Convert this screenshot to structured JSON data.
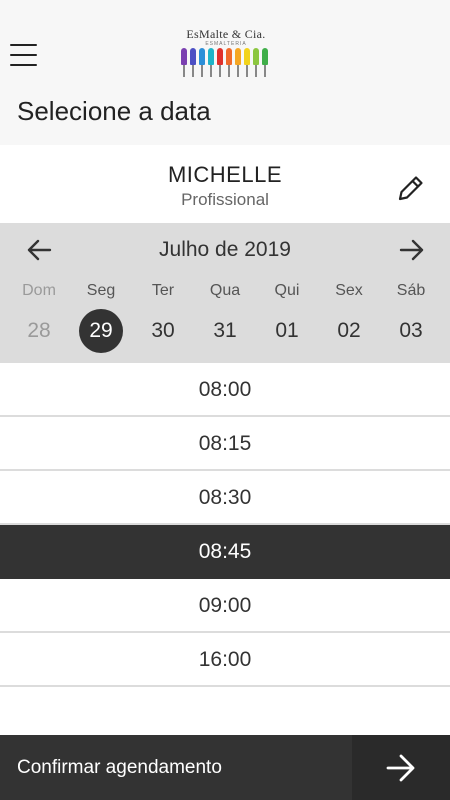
{
  "header": {
    "logo_text": "EsMalte & Cia.",
    "logo_subtext": "ESMALTERIA",
    "brush_colors": [
      "#7a3fb0",
      "#4b4fc4",
      "#2b8fd8",
      "#1fb4c8",
      "#e0302c",
      "#f06a2b",
      "#f5a623",
      "#f2d31b",
      "#8cc63f",
      "#3fae49"
    ]
  },
  "page": {
    "title": "Selecione a data"
  },
  "professional": {
    "name": "MICHELLE",
    "role": "Profissional"
  },
  "calendar": {
    "month_label": "Julho de 2019",
    "days": [
      {
        "name": "Dom",
        "num": "28",
        "state": "muted"
      },
      {
        "name": "Seg",
        "num": "29",
        "state": "selected"
      },
      {
        "name": "Ter",
        "num": "30",
        "state": "normal"
      },
      {
        "name": "Qua",
        "num": "31",
        "state": "normal"
      },
      {
        "name": "Qui",
        "num": "01",
        "state": "normal"
      },
      {
        "name": "Sex",
        "num": "02",
        "state": "normal"
      },
      {
        "name": "Sáb",
        "num": "03",
        "state": "normal"
      }
    ]
  },
  "time_slots": [
    {
      "time": "08:00",
      "active": false
    },
    {
      "time": "08:15",
      "active": false
    },
    {
      "time": "08:30",
      "active": false
    },
    {
      "time": "08:45",
      "active": true
    },
    {
      "time": "09:00",
      "active": false
    },
    {
      "time": "16:00",
      "active": false
    }
  ],
  "footer": {
    "confirm_label": "Confirmar agendamento"
  },
  "colors": {
    "dark": "#333333",
    "calendar_bg": "#dcdcdc",
    "muted": "#9a9a9a"
  },
  "icons": {
    "menu": "hamburger-icon",
    "edit": "pencil-icon",
    "prev": "arrow-left-icon",
    "next": "arrow-right-icon",
    "confirm": "arrow-right-icon"
  }
}
